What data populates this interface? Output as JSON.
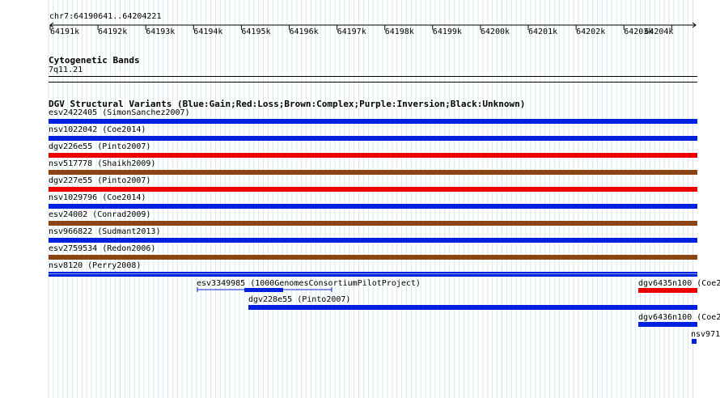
{
  "ruler": {
    "range_label": "chr7:64190641..64204221",
    "ticks": [
      "64191k",
      "64192k",
      "64193k",
      "64194k",
      "64195k",
      "64196k",
      "64197k",
      "64198k",
      "64199k",
      "64200k",
      "64201k",
      "64202k",
      "64203k",
      "64204k"
    ]
  },
  "cytoband": {
    "title": "Cytogenetic Bands",
    "band": "7q11.21"
  },
  "dgv": {
    "title": "DGV Structural Variants (Blue:Gain;Red:Loss;Brown:Complex;Purple:Inversion;Black:Unknown)",
    "colors": {
      "gain": "#0022e0",
      "loss": "#ee0000",
      "complex": "#8b4513"
    },
    "rows": [
      {
        "label": "esv2422405 (SimonSanchez2007)",
        "type": "gain"
      },
      {
        "label": "nsv1022042 (Coe2014)",
        "type": "gain"
      },
      {
        "label": "dgv226e55 (Pinto2007)",
        "type": "loss"
      },
      {
        "label": "nsv517778 (Shaikh2009)",
        "type": "complex"
      },
      {
        "label": "dgv227e55 (Pinto2007)",
        "type": "loss"
      },
      {
        "label": "nsv1029796 (Coe2014)",
        "type": "gain"
      },
      {
        "label": "esv24002 (Conrad2009)",
        "type": "complex"
      },
      {
        "label": "nsv966822 (Sudmant2013)",
        "type": "gain"
      },
      {
        "label": "esv2759534 (Redon2006)",
        "type": "complex"
      },
      {
        "label": "nsv8120 (Perry2008)",
        "type": "gain"
      }
    ],
    "lower_features": [
      {
        "label": "esv3349985 (1000GenomesConsortiumPilotProject)"
      },
      {
        "label": "dgv228e55 (Pinto2007)"
      },
      {
        "label": "dgv6435n100 (Coe2"
      },
      {
        "label": "dgv6436n100 (Coe2"
      },
      {
        "label": "nsv971"
      }
    ]
  }
}
